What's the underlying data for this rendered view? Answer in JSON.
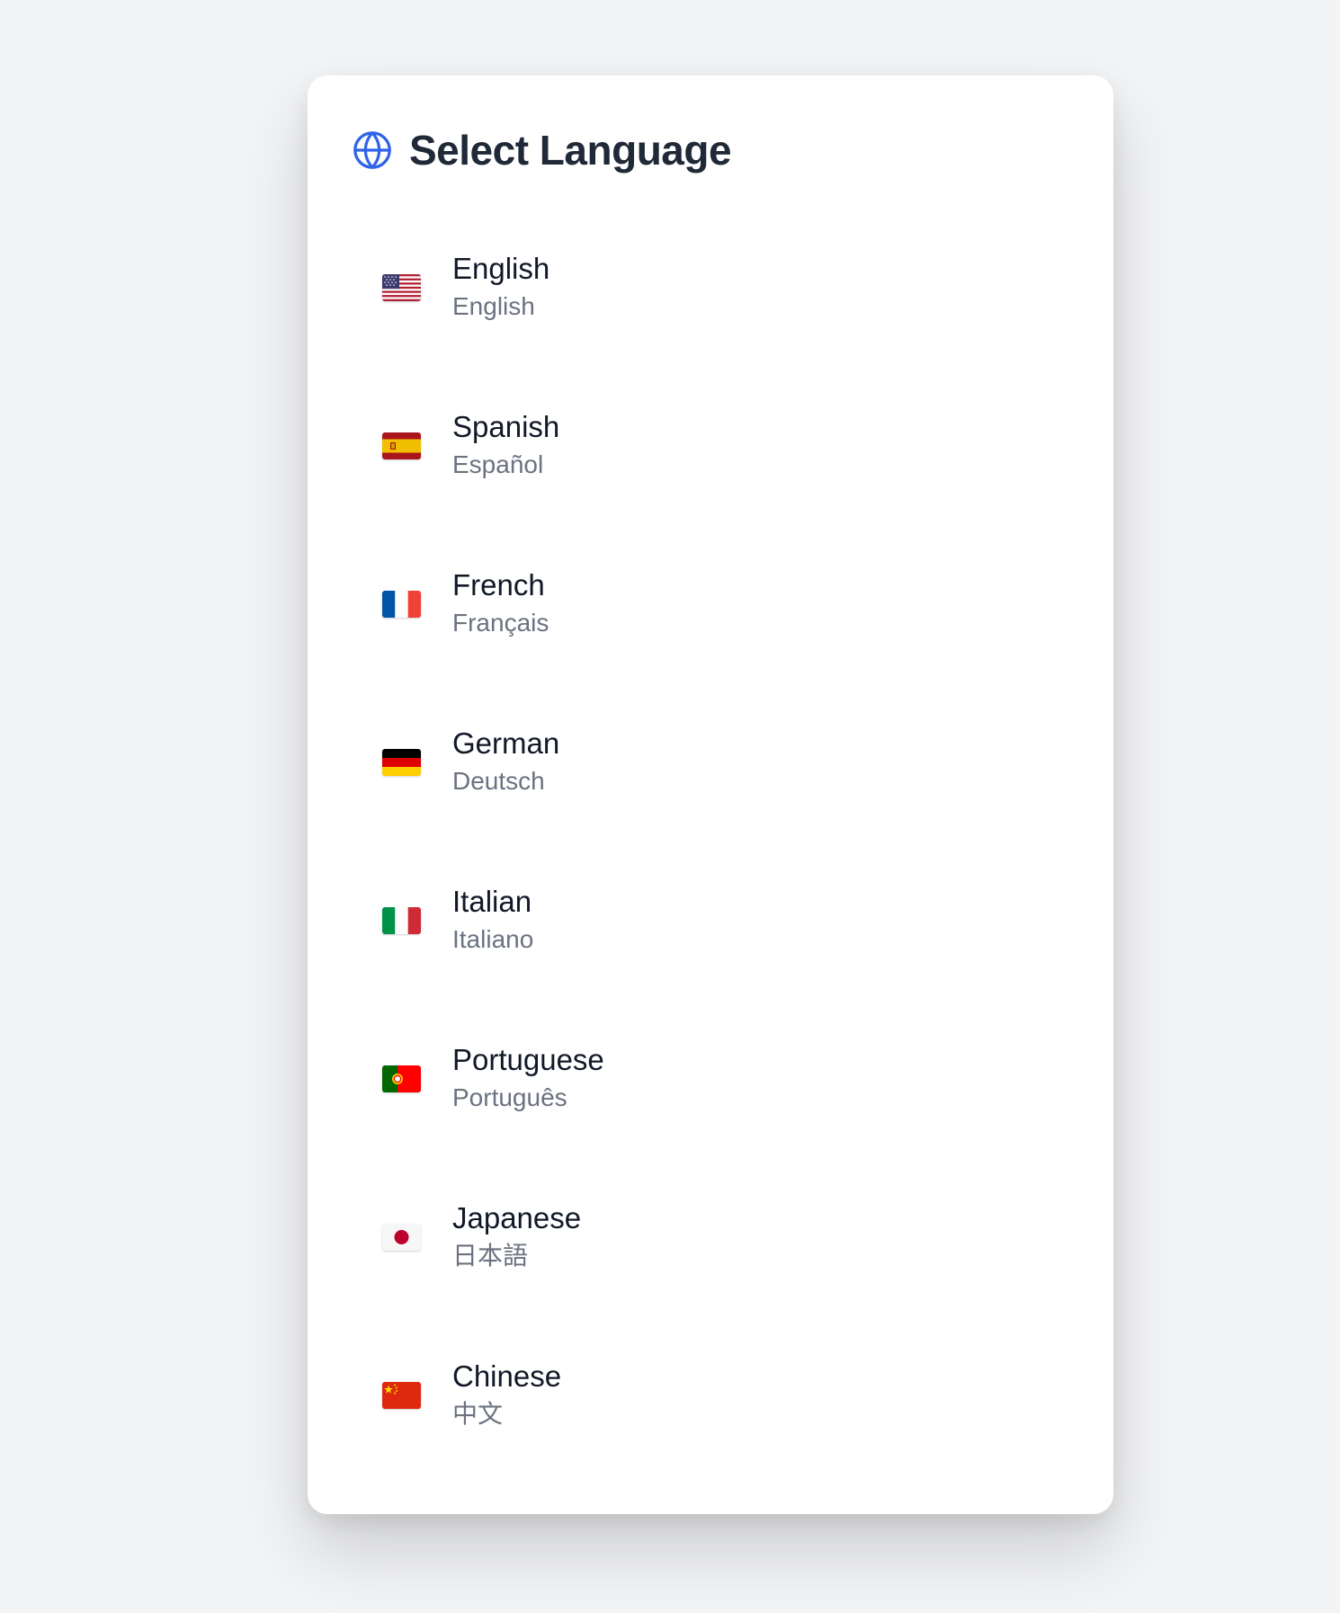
{
  "dialog": {
    "title": "Select Language",
    "title_icon": "globe-icon",
    "accent_color": "#2f63e8"
  },
  "languages": [
    {
      "name": "English",
      "native": "English",
      "flag": "us-flag-icon"
    },
    {
      "name": "Spanish",
      "native": "Español",
      "flag": "spain-flag-icon"
    },
    {
      "name": "French",
      "native": "Français",
      "flag": "france-flag-icon"
    },
    {
      "name": "German",
      "native": "Deutsch",
      "flag": "germany-flag-icon"
    },
    {
      "name": "Italian",
      "native": "Italiano",
      "flag": "italy-flag-icon"
    },
    {
      "name": "Portuguese",
      "native": "Português",
      "flag": "portugal-flag-icon"
    },
    {
      "name": "Japanese",
      "native": "日本語",
      "flag": "japan-flag-icon"
    },
    {
      "name": "Chinese",
      "native": "中文",
      "flag": "china-flag-icon"
    }
  ]
}
